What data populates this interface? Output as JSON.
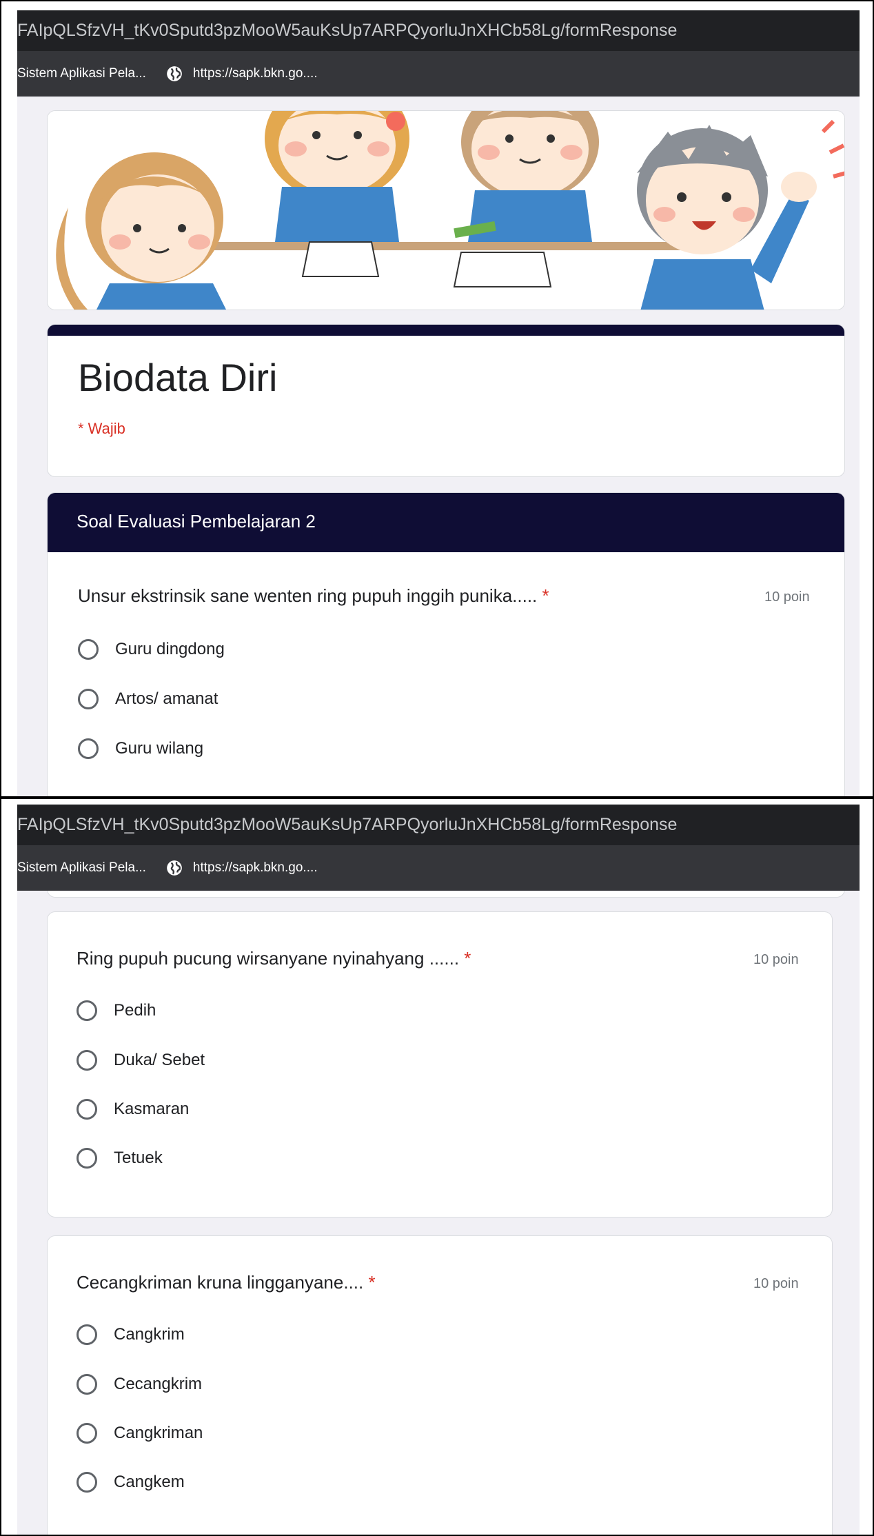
{
  "browser": {
    "url_fragment": "FAIpQLSfzVH_tKv0Sputd3pzMooW5auKsUp7ARPQyorluJnXHCb58Lg/formResponse",
    "bookmarks": [
      {
        "label": "Sistem Aplikasi Pela...",
        "icon": "bookmark"
      },
      {
        "label": "https://sapk.bkn.go....",
        "icon": "globe-icon"
      }
    ]
  },
  "form": {
    "title": "Biodata Diri",
    "required_note": "* Wajib",
    "section_title": "Soal Evaluasi Pembelajaran 2",
    "accent_color": "#0f0d35"
  },
  "questions": [
    {
      "text": "Unsur ekstrinsik sane wenten ring pupuh inggih punika..... ",
      "required_mark": "*",
      "points": "10 poin",
      "options": [
        "Guru dingdong",
        "Artos/ amanat",
        "Guru wilang"
      ]
    },
    {
      "text": "Ring pupuh pucung wirsanyane nyinahyang ...... ",
      "required_mark": "*",
      "points": "10 poin",
      "options": [
        "Pedih",
        "Duka/ Sebet",
        "Kasmaran",
        "Tetuek"
      ]
    },
    {
      "text": "Cecangkriman kruna lingganyane.... ",
      "required_mark": "*",
      "points": "10 poin",
      "options": [
        "Cangkrim",
        "Cecangkrim",
        "Cangkriman",
        "Cangkem"
      ]
    }
  ]
}
